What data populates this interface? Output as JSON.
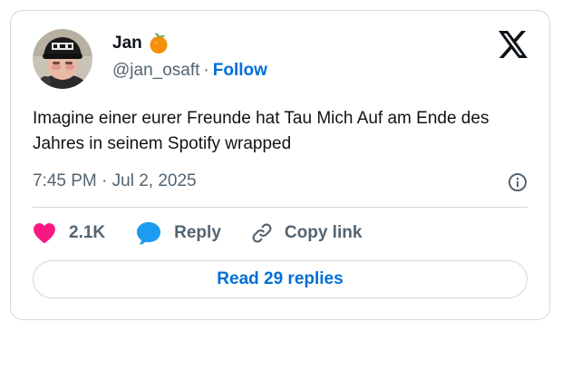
{
  "tweet": {
    "author": {
      "name": "Jan",
      "badge_emoji": "orange-emoji",
      "handle": "@jan_osaft",
      "separator": "·",
      "follow_label": "Follow"
    },
    "brand_icon": "x-logo-icon",
    "text": "Imagine einer eurer Freunde hat Tau Mich Auf am Ende des Jahres in seinem Spotify wrapped",
    "timestamp": "7:45 PM · Jul 2, 2025",
    "info_icon": "info-icon",
    "actions": {
      "like_count": "2.1K",
      "reply_label": "Reply",
      "copy_link_label": "Copy link"
    },
    "read_replies_label": "Read 29 replies"
  },
  "colors": {
    "link_blue": "#006fd6",
    "heart_pink": "#f91880",
    "reply_blue": "#1d9bf0",
    "muted_text": "#536471",
    "border": "#cfd9de",
    "primary_text": "#0f1419"
  }
}
